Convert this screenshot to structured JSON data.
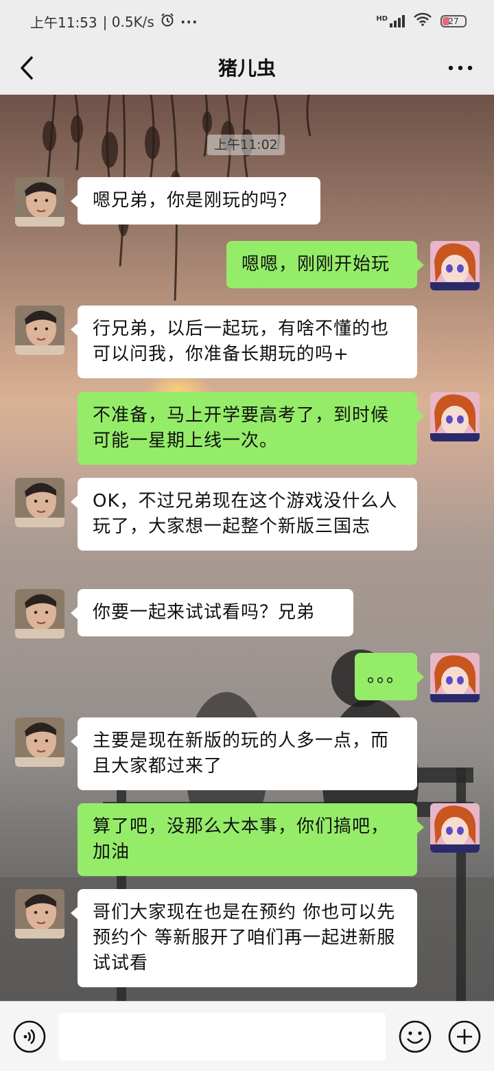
{
  "status_bar": {
    "time": "上午11:53",
    "speed": "| 0.5K/s",
    "more": "···",
    "network": "HD",
    "battery": "27"
  },
  "header": {
    "title": "猪儿虫"
  },
  "chat": {
    "timestamp": "上午11:02",
    "messages": [
      {
        "side": "left",
        "text": "嗯兄弟，你是刚玩的吗？"
      },
      {
        "side": "right",
        "text": "嗯嗯，刚刚开始玩"
      },
      {
        "side": "left",
        "text": "行兄弟，以后一起玩，有啥不懂的也可以问我，你准备长期玩的吗+"
      },
      {
        "side": "right",
        "text": "不准备，马上开学要高考了，到时候可能一星期上线一次。"
      },
      {
        "side": "left",
        "text": "OK，不过兄弟现在这个游戏没什么人玩了，大家想一起整个新版三国志"
      },
      {
        "side": "left",
        "text": "你要一起来试试看吗？兄弟"
      },
      {
        "side": "right",
        "text": "。。。"
      },
      {
        "side": "left",
        "text": "主要是现在新版的玩的人多一点，而且大家都过来了"
      },
      {
        "side": "right",
        "text": "算了吧，没那么大本事，你们搞吧，加油"
      },
      {
        "side": "left",
        "text": "哥们大家现在也是在预约 你也可以先预约个 等新服开了咱们再一起进新服试试看"
      }
    ]
  },
  "input_bar": {
    "value": "",
    "icons": [
      "voice-icon",
      "emoji-icon",
      "plus-icon"
    ]
  },
  "colors": {
    "bubble_self": "#95ec69",
    "bubble_other": "#ffffff",
    "bar_bg": "#ededed"
  }
}
